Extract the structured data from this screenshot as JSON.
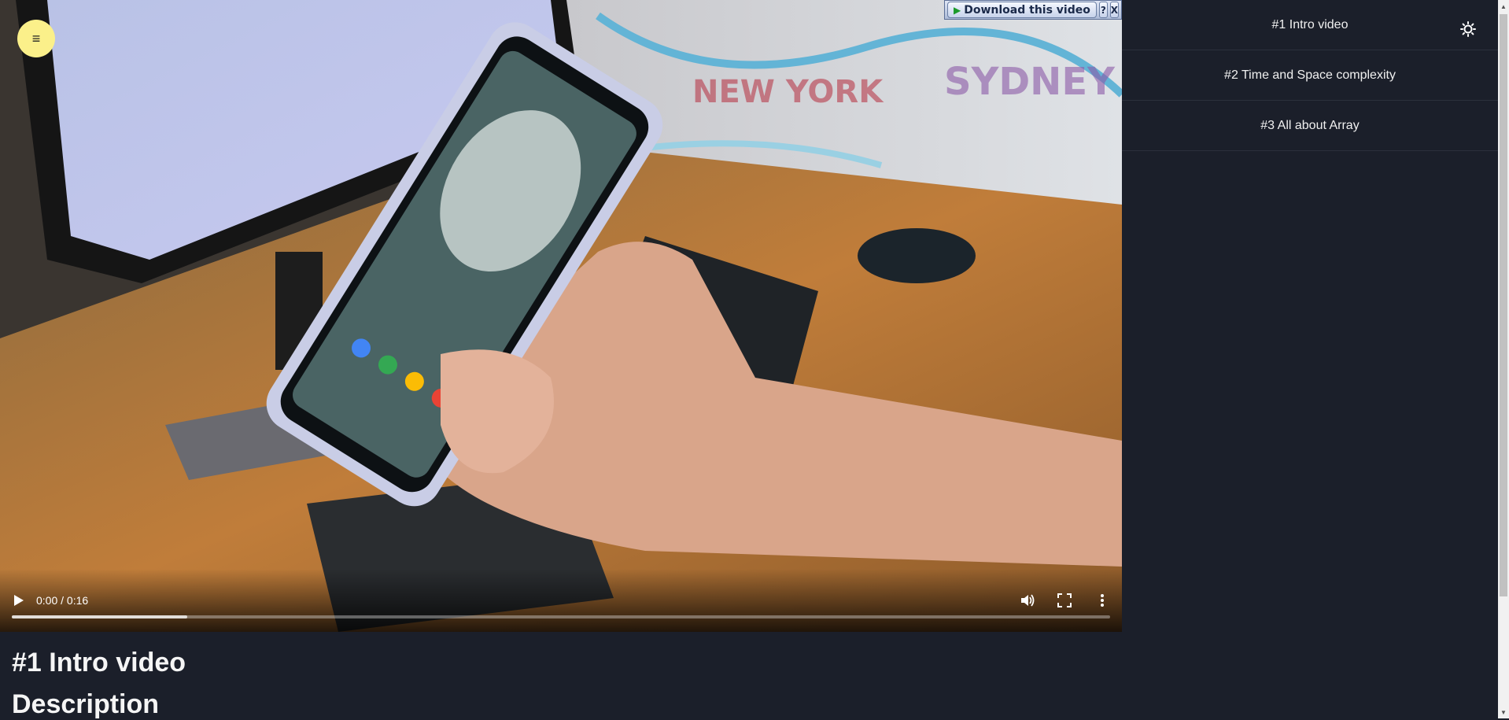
{
  "menu_button": {
    "label": "≡"
  },
  "download_bar": {
    "label": "Download this video",
    "help": "?",
    "close": "X"
  },
  "player": {
    "time": "0:00 / 0:16",
    "progress_percent": 0,
    "buffered_percent": 16,
    "icons": {
      "play": "play-icon",
      "volume": "volume-icon",
      "fullscreen": "fullscreen-icon",
      "more": "more-vert-icon"
    }
  },
  "sidebar": {
    "items": [
      {
        "label": "#1 Intro video"
      },
      {
        "label": "#2 Time and Space complexity"
      },
      {
        "label": "#3 All about Array"
      }
    ],
    "theme_icon": "sun-icon"
  },
  "main": {
    "title": "#1 Intro video",
    "description_heading": "Description"
  },
  "colors": {
    "background": "#1b1f2a",
    "menu_button": "#fbf08a"
  }
}
